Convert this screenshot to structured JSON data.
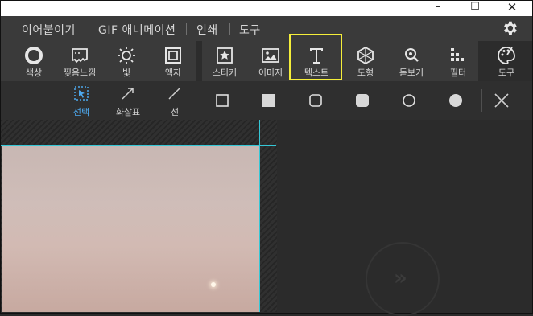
{
  "menu": {
    "items": [
      {
        "label": "이어붙이기"
      },
      {
        "label": "GIF 애니메이션"
      },
      {
        "label": "인쇄"
      },
      {
        "label": "도구"
      }
    ]
  },
  "toolbar": {
    "left_tools": [
      {
        "label": "색상",
        "icon": "ring-icon"
      },
      {
        "label": "찢음느낌",
        "icon": "torn-edge-icon"
      },
      {
        "label": "빛",
        "icon": "sun-icon"
      },
      {
        "label": "액자",
        "icon": "frame-icon"
      }
    ],
    "right_tools": [
      {
        "label": "스티커",
        "icon": "sticker-icon"
      },
      {
        "label": "이미지",
        "icon": "image-icon"
      },
      {
        "label": "텍스트",
        "icon": "text-icon",
        "highlighted": true
      },
      {
        "label": "도형",
        "icon": "shape-icon"
      },
      {
        "label": "돋보기",
        "icon": "magnifier-icon"
      },
      {
        "label": "필터",
        "icon": "filter-icon"
      }
    ],
    "tools_label": "도구"
  },
  "shapebar": {
    "select_label": "선택",
    "arrow_label": "화살표",
    "line_label": "선"
  },
  "colors": {
    "accent": "#35c7d6",
    "highlight": "#f5ee3a",
    "select_label": "#4da8ee"
  }
}
